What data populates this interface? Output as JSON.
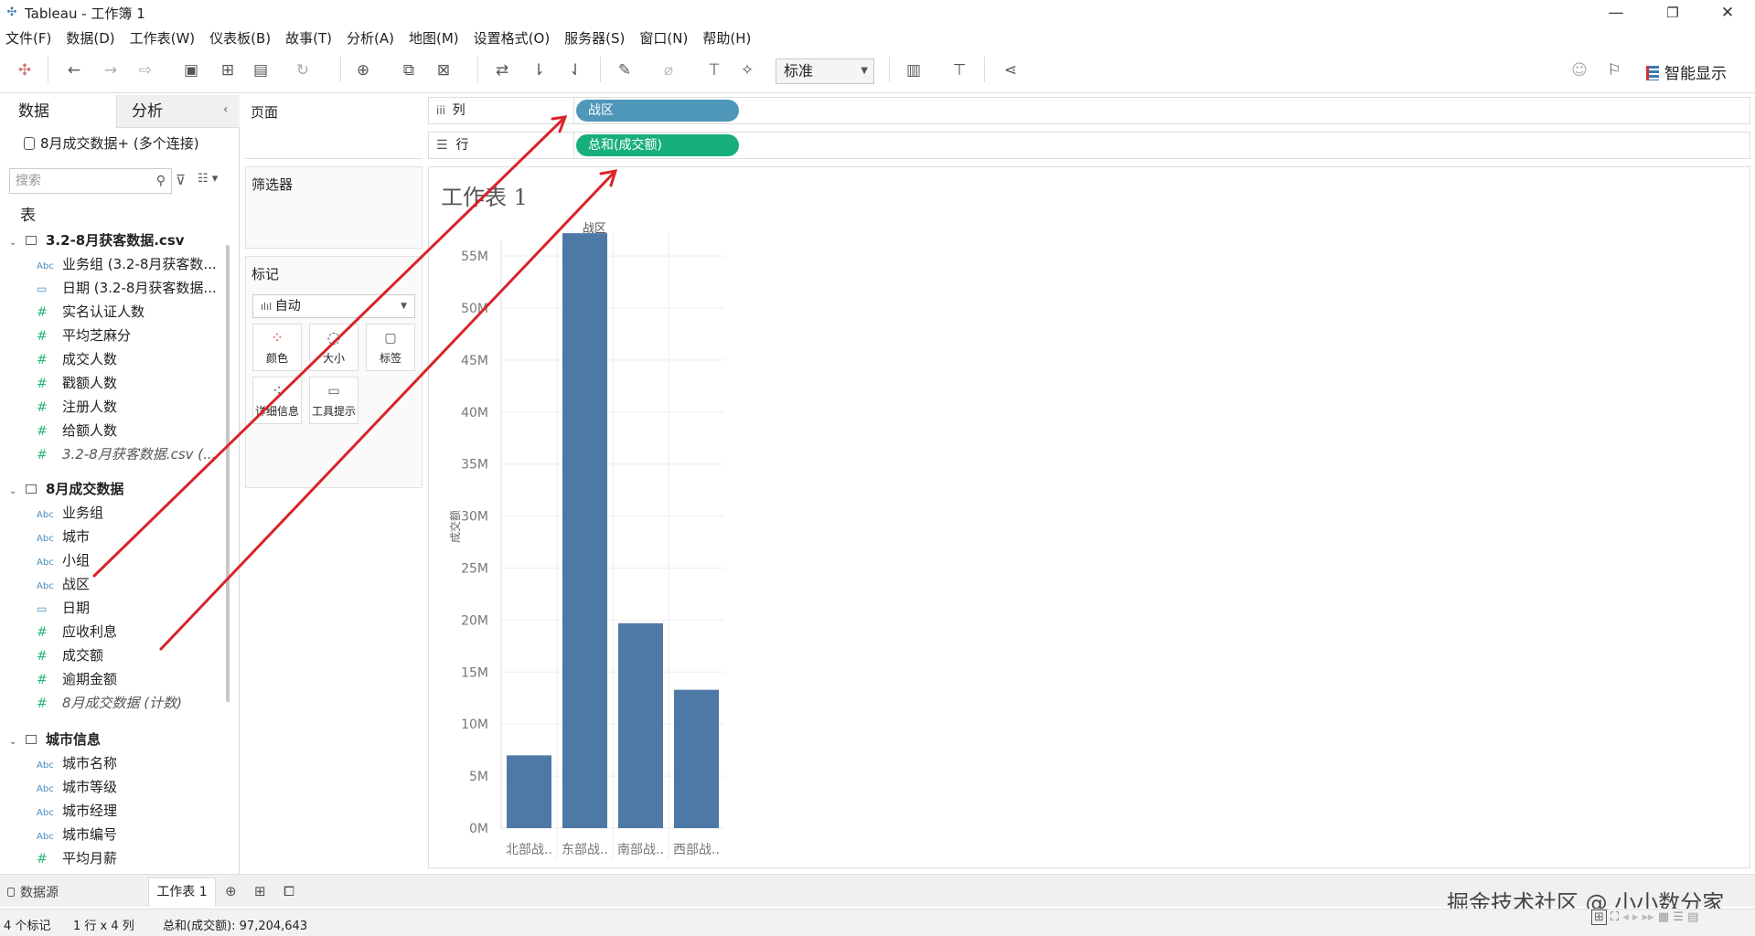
{
  "window": {
    "title": "Tableau - 工作簿 1",
    "controls": [
      "—",
      "❐",
      "✕"
    ]
  },
  "menu": [
    "文件(F)",
    "数据(D)",
    "工作表(W)",
    "仪表板(B)",
    "故事(T)",
    "分析(A)",
    "地图(M)",
    "设置格式(O)",
    "服务器(S)",
    "窗口(N)",
    "帮助(H)"
  ],
  "toolbar": {
    "fit_select": "标准",
    "smart_show": "智能显示"
  },
  "left_pane": {
    "tabs": [
      "数据",
      "分析"
    ],
    "connection": "8月成交数据+ (多个连接)",
    "search_placeholder": "搜索",
    "tables_label": "表",
    "tables": [
      {
        "name": "3.2-8月获客数据.csv",
        "fields": [
          {
            "type": "Abc",
            "label": "业务组 (3.2-8月获客数...",
            "italic": false
          },
          {
            "type": "date",
            "label": "日期 (3.2-8月获客数据...",
            "italic": false
          },
          {
            "type": "#",
            "label": "实名认证人数",
            "italic": false
          },
          {
            "type": "#",
            "label": "平均芝麻分",
            "italic": false
          },
          {
            "type": "#",
            "label": "成交人数",
            "italic": false
          },
          {
            "type": "#",
            "label": "戳额人数",
            "italic": false
          },
          {
            "type": "#",
            "label": "注册人数",
            "italic": false
          },
          {
            "type": "#",
            "label": "给额人数",
            "italic": false
          },
          {
            "type": "#",
            "label": "3.2-8月获客数据.csv (...",
            "italic": true
          }
        ]
      },
      {
        "name": "8月成交数据",
        "fields": [
          {
            "type": "Abc",
            "label": "业务组",
            "italic": false
          },
          {
            "type": "Abc",
            "label": "城市",
            "italic": false
          },
          {
            "type": "Abc",
            "label": "小组",
            "italic": false
          },
          {
            "type": "Abc",
            "label": "战区",
            "italic": false
          },
          {
            "type": "date",
            "label": "日期",
            "italic": false
          },
          {
            "type": "#",
            "label": "应收利息",
            "italic": false
          },
          {
            "type": "#",
            "label": "成交额",
            "italic": false
          },
          {
            "type": "#",
            "label": "逾期金额",
            "italic": false
          },
          {
            "type": "#",
            "label": "8月成交数据 (计数)",
            "italic": true
          }
        ]
      },
      {
        "name": "城市信息",
        "fields": [
          {
            "type": "Abc",
            "label": "城市名称",
            "italic": false
          },
          {
            "type": "Abc",
            "label": "城市等级",
            "italic": false
          },
          {
            "type": "Abc",
            "label": "城市经理",
            "italic": false
          },
          {
            "type": "Abc",
            "label": "城市编号",
            "italic": false
          },
          {
            "type": "#",
            "label": "平均月薪",
            "italic": false
          }
        ]
      }
    ]
  },
  "cards": {
    "pages": "页面",
    "filters": "筛选器",
    "marks": "标记",
    "marks_type": "自动",
    "mark_buttons": [
      {
        "label": "颜色",
        "icon": "color-icon"
      },
      {
        "label": "大小",
        "icon": "size-icon"
      },
      {
        "label": "标签",
        "icon": "label-icon"
      },
      {
        "label": "详细信息",
        "icon": "detail-icon"
      },
      {
        "label": "工具提示",
        "icon": "tooltip-icon"
      }
    ]
  },
  "shelves": {
    "columns_label": "列",
    "rows_label": "行",
    "columns_pill": "战区",
    "rows_pill": "总和(成交额)",
    "columns_pill_color": "#4e97b8",
    "rows_pill_color": "#18b07a"
  },
  "sheet_title": "工作表 1",
  "chart_data": {
    "type": "bar",
    "title": "",
    "header": "战区",
    "xlabel": "",
    "ylabel": "成交额",
    "categories": [
      "北部战..",
      "东部战..",
      "南部战..",
      "西部战.."
    ],
    "values": [
      7000000,
      57200000,
      19700000,
      13300000
    ],
    "ylim": [
      0,
      58000000
    ],
    "yticks": [
      0,
      5000000,
      10000000,
      15000000,
      20000000,
      25000000,
      30000000,
      35000000,
      40000000,
      45000000,
      50000000,
      55000000
    ],
    "ytick_labels": [
      "0M",
      "5M",
      "10M",
      "15M",
      "20M",
      "25M",
      "30M",
      "35M",
      "40M",
      "45M",
      "50M",
      "55M"
    ],
    "bar_color": "#4e79a7",
    "grid": true
  },
  "bottom_tabs": {
    "datasource": "数据源",
    "sheet": "工作表 1"
  },
  "status": {
    "marks": "4 个标记",
    "dims": "1 行 x 4 列",
    "sum": "总和(成交额): 97,204,643"
  },
  "watermark": "掘金技术社区 @ 小小数分家",
  "annotation_color": "#d8242b"
}
